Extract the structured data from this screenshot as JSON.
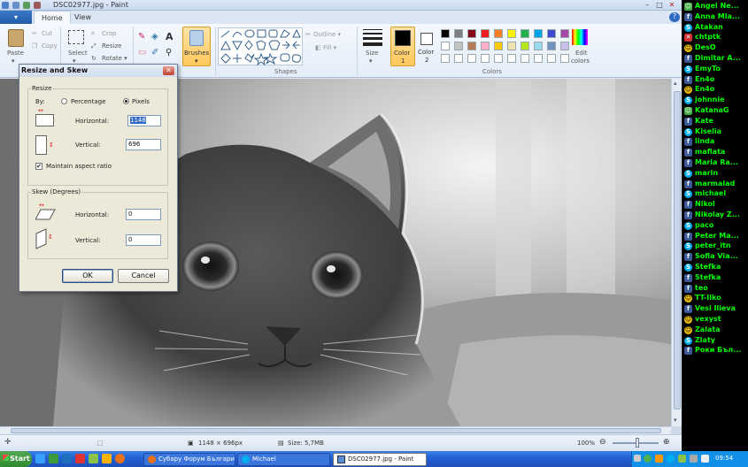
{
  "window": {
    "title": "DSC02977.jpg - Paint",
    "controls": {
      "minimize": "–",
      "maximize": "□",
      "close": "✕"
    }
  },
  "ribbon": {
    "file_label": "▾",
    "tabs": [
      {
        "label": "Home"
      },
      {
        "label": "View"
      }
    ],
    "clipboard": {
      "paste": "Paste",
      "cut": "Cut",
      "copy": "Copy"
    },
    "image": {
      "select": "Select",
      "crop": "Crop",
      "resize": "Resize",
      "rotate": "Rotate ▾"
    },
    "brushes": "Brushes",
    "shapes": {
      "outline": "Outline ▾",
      "fill": "Fill ▾",
      "group_label": "Shapes"
    },
    "size": "Size",
    "color1": {
      "label": "Color",
      "num": "1",
      "value": "#000000"
    },
    "color2": {
      "label": "Color",
      "num": "2",
      "value": "#ffffff"
    },
    "colors_group_label": "Colors",
    "edit_colors": {
      "line1": "Edit",
      "line2": "colors"
    },
    "palette": [
      "#000000",
      "#7f7f7f",
      "#880015",
      "#ed1c24",
      "#ff7f27",
      "#fff200",
      "#22b14c",
      "#00a2e8",
      "#3f48cc",
      "#a349a4",
      "#ffffff",
      "#c3c3c3",
      "#b97a57",
      "#ffaec9",
      "#ffc90e",
      "#efe4b0",
      "#b5e61d",
      "#99d9ea",
      "#7092be",
      "#c8bfe7"
    ]
  },
  "dialog": {
    "title": "Resize and Skew",
    "resize": {
      "legend": "Resize",
      "by_label": "By:",
      "percentage": "Percentage",
      "pixels": "Pixels",
      "horizontal_label": "Horizontal:",
      "horizontal_value": "1148",
      "vertical_label": "Vertical:",
      "vertical_value": "696",
      "aspect_label": "Maintain aspect ratio",
      "aspect_checked": "✔"
    },
    "skew": {
      "legend": "Skew (Degrees)",
      "horizontal_label": "Horizontal:",
      "horizontal_value": "0",
      "vertical_label": "Vertical:",
      "vertical_value": "0"
    },
    "ok": "OK",
    "cancel": "Cancel"
  },
  "statusbar": {
    "dimensions": "1148 × 696px",
    "size": "Size: 5,7MB",
    "zoom": "100%",
    "zoom_minus": "⊖",
    "zoom_plus": "⊕"
  },
  "taskbar": {
    "start": "Start",
    "items": [
      {
        "label": "Субару Форум България..."
      },
      {
        "label": "Michael"
      },
      {
        "label": "DSC02977.jpg - Paint"
      }
    ],
    "clock": "09:54"
  },
  "chat": {
    "contacts": [
      {
        "name": "Angel Ne...",
        "icon": "user-icon"
      },
      {
        "name": "Anna Mla...",
        "icon": "facebook-icon"
      },
      {
        "name": "Atakan",
        "icon": "skype-icon"
      },
      {
        "name": "chtptk",
        "icon": "block-icon"
      },
      {
        "name": "DesO",
        "icon": "yahoo-icon"
      },
      {
        "name": "Dimitar A...",
        "icon": "facebook-icon"
      },
      {
        "name": "EmyTo",
        "icon": "skype-icon"
      },
      {
        "name": "En4o",
        "icon": "facebook-icon"
      },
      {
        "name": "En4o",
        "icon": "yahoo-icon"
      },
      {
        "name": "johnnie",
        "icon": "skype-icon"
      },
      {
        "name": "KatanaG",
        "icon": "user-icon"
      },
      {
        "name": "Kate",
        "icon": "facebook-icon"
      },
      {
        "name": "Kiselia",
        "icon": "skype-icon"
      },
      {
        "name": "linda",
        "icon": "facebook-icon"
      },
      {
        "name": "mafiata",
        "icon": "facebook-icon"
      },
      {
        "name": "Maria Ra...",
        "icon": "facebook-icon"
      },
      {
        "name": "marin",
        "icon": "skype-icon"
      },
      {
        "name": "marmalad",
        "icon": "facebook-icon"
      },
      {
        "name": "michael",
        "icon": "skype-icon"
      },
      {
        "name": "Nikol",
        "icon": "facebook-icon"
      },
      {
        "name": "Nikolay Z...",
        "icon": "facebook-icon"
      },
      {
        "name": "paco",
        "icon": "skype-icon"
      },
      {
        "name": "Peter Ma...",
        "icon": "facebook-icon"
      },
      {
        "name": "peter_itn",
        "icon": "skype-icon"
      },
      {
        "name": "Sofia Via...",
        "icon": "facebook-icon"
      },
      {
        "name": "Stefka",
        "icon": "skype-icon"
      },
      {
        "name": "Stefka",
        "icon": "facebook-icon"
      },
      {
        "name": "teo",
        "icon": "facebook-icon"
      },
      {
        "name": "TT-Ilko",
        "icon": "yahoo-icon"
      },
      {
        "name": "Vesi Ilieva",
        "icon": "facebook-icon"
      },
      {
        "name": "vexyst",
        "icon": "yahoo-icon"
      },
      {
        "name": "Zalata",
        "icon": "yahoo-icon"
      },
      {
        "name": "Zlaty",
        "icon": "skype-icon"
      },
      {
        "name": "Роки Бъл...",
        "icon": "facebook-icon"
      }
    ]
  }
}
